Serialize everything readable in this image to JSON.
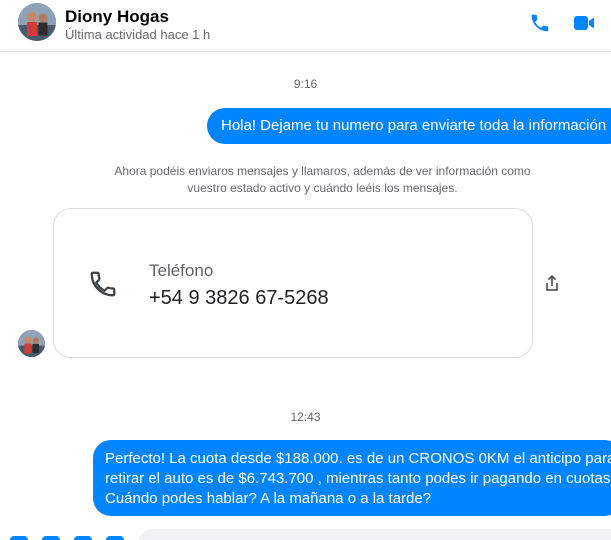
{
  "header": {
    "contact_name": "Diony Hogas",
    "status": "Última actividad hace 1 h",
    "accent_color": "#0084ff",
    "icons": [
      "phone-icon",
      "video-call-icon"
    ]
  },
  "messages": {
    "time_1": "9:16",
    "outgoing_1": "Hola! Dejame tu numero  para enviarte toda la información",
    "notice_line_1": "Ahora podéis enviaros mensajes y llamaros, además de ver información como",
    "notice_line_2": "vuestro estado activo y cuándo leéis los mensajes.",
    "contact_card": {
      "label": "Teléfono",
      "value": "+54 9 3826 67-5268"
    },
    "time_2": "12:43",
    "outgoing_2_lines": [
      "Perfecto! La cuota desde $188.000. es de un CRONOS 0KM el anticipo para",
      "retirar el auto es de $6.743.700 , mientras tanto podes ir pagando en cuotas.",
      "Cuándo podes hablar? A la mañana o a la tarde?"
    ]
  }
}
